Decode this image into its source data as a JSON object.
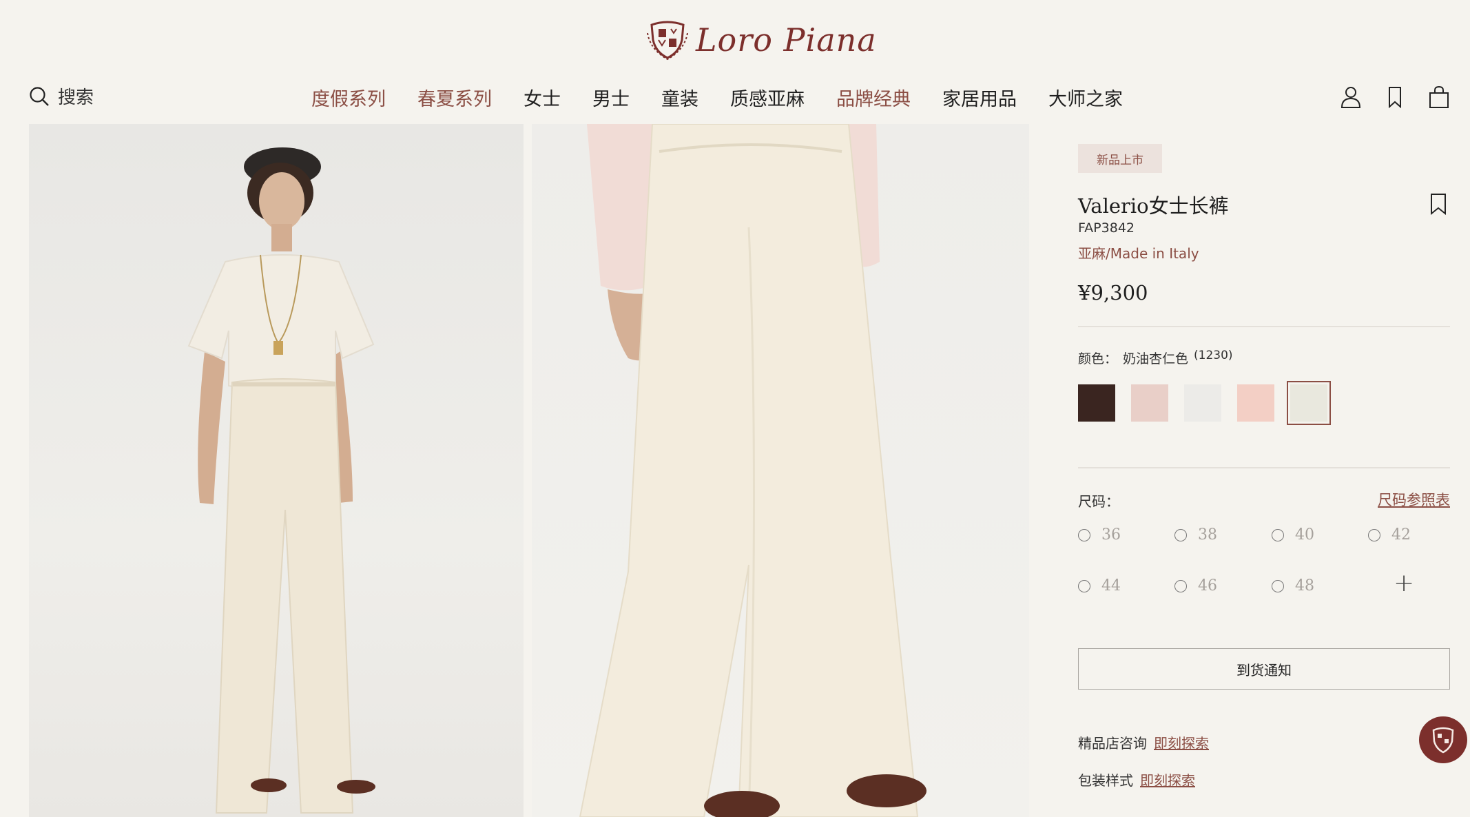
{
  "brand": {
    "logo_text": "Loro Piana",
    "brand_color": "#7c2f2c"
  },
  "header": {
    "search_label": "搜索",
    "search_icon": "search-icon",
    "nav": [
      {
        "label": "度假系列",
        "accent": true
      },
      {
        "label": "春夏系列",
        "accent": true
      },
      {
        "label": "女士",
        "accent": false
      },
      {
        "label": "男士",
        "accent": false
      },
      {
        "label": "童装",
        "accent": false
      },
      {
        "label": "质感亚麻",
        "accent": false
      },
      {
        "label": "品牌经典",
        "accent": true
      },
      {
        "label": "家居用品",
        "accent": false
      },
      {
        "label": "大师之家",
        "accent": false
      }
    ],
    "icons": [
      "account-icon",
      "bookmark-icon",
      "shopping-bag-icon"
    ]
  },
  "product": {
    "badge": "新品上市",
    "title": "Valerio女士长裤",
    "sku": "FAP3842",
    "material": "亚麻/Made in Italy",
    "price": "¥9,300",
    "color_label": "颜色：",
    "color_name": "奶油杏仁色",
    "color_code": "(1230)",
    "swatches": [
      {
        "color": "#3a2520",
        "selected": false
      },
      {
        "color": "#e9cfc8",
        "selected": false
      },
      {
        "color": "#ecebe8",
        "selected": false
      },
      {
        "color": "#f3cfc5",
        "selected": false
      },
      {
        "color": "#e9e8de",
        "selected": true
      }
    ],
    "size_label": "尺码：",
    "size_guide": "尺码参照表",
    "sizes": [
      "36",
      "38",
      "40",
      "42",
      "44",
      "46",
      "48"
    ],
    "more_sizes_icon": "plus-icon",
    "notify_button": "到货通知",
    "boutique_label": "精品店咨询",
    "boutique_link": "即刻探索",
    "packaging_label": "包装样式",
    "packaging_link": "即刻探索",
    "accent_color": "#8b4e44"
  },
  "images": {
    "left_alt": "model-full-body",
    "right_alt": "trousers-closeup"
  }
}
